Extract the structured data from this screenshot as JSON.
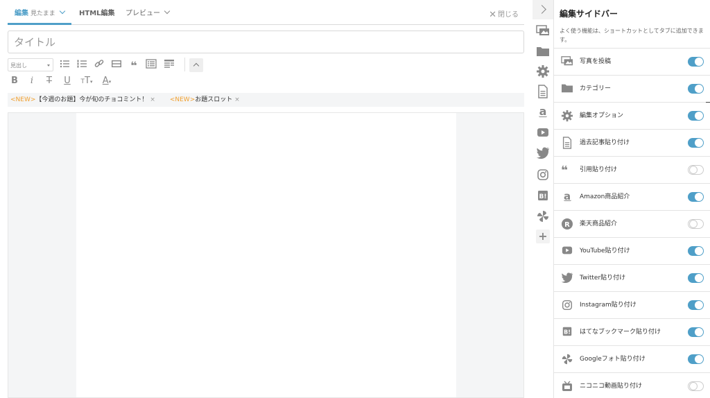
{
  "tabs": {
    "edit_label": "編集",
    "edit_sub": "見たまま",
    "html_label": "HTML編集",
    "preview_label": "プレビュー",
    "close_label": "閉じる"
  },
  "title_input": {
    "placeholder": "タイトル",
    "value": ""
  },
  "toolbar": {
    "heading_select_value": "見出し"
  },
  "topics": [
    {
      "badge": "<NEW>",
      "text": "【今週のお題】今が旬のチョコミント！"
    },
    {
      "badge": "<NEW>",
      "text": "お題スロット"
    }
  ],
  "rail": {
    "icons": [
      "photo-icon",
      "folder-icon",
      "gear-icon",
      "document-icon",
      "amazon-icon",
      "youtube-icon",
      "twitter-icon",
      "instagram-icon",
      "hatena-bookmark-icon",
      "google-photos-icon"
    ],
    "add_label": "+"
  },
  "sidebar": {
    "title": "編集サイドバー",
    "description": "よく使う機能は、ショートカットとしてタブに追加できます。",
    "items": [
      {
        "label": "写真を投稿",
        "icon": "photo-icon",
        "enabled": true
      },
      {
        "label": "カテゴリー",
        "icon": "folder-icon",
        "enabled": true
      },
      {
        "label": "編集オプション",
        "icon": "gear-icon",
        "enabled": true
      },
      {
        "label": "過去記事貼り付け",
        "icon": "document-icon",
        "enabled": true
      },
      {
        "label": "引用貼り付け",
        "icon": "quote-icon",
        "enabled": false
      },
      {
        "label": "Amazon商品紹介",
        "icon": "amazon-icon",
        "enabled": true
      },
      {
        "label": "楽天商品紹介",
        "icon": "rakuten-icon",
        "enabled": false
      },
      {
        "label": "YouTube貼り付け",
        "icon": "youtube-icon",
        "enabled": true
      },
      {
        "label": "Twitter貼り付け",
        "icon": "twitter-icon",
        "enabled": true
      },
      {
        "label": "Instagram貼り付け",
        "icon": "instagram-icon",
        "enabled": true
      },
      {
        "label": "はてなブックマーク貼り付け",
        "icon": "hatena-bookmark-icon",
        "enabled": true
      },
      {
        "label": "Googleフォト貼り付け",
        "icon": "google-photos-icon",
        "enabled": true
      },
      {
        "label": "ニコニコ動画貼り付け",
        "icon": "niconico-icon",
        "enabled": false
      }
    ]
  },
  "colors": {
    "accent": "#4f9fc8",
    "new_badge": "#f0a030",
    "icon_gray": "#888888"
  }
}
